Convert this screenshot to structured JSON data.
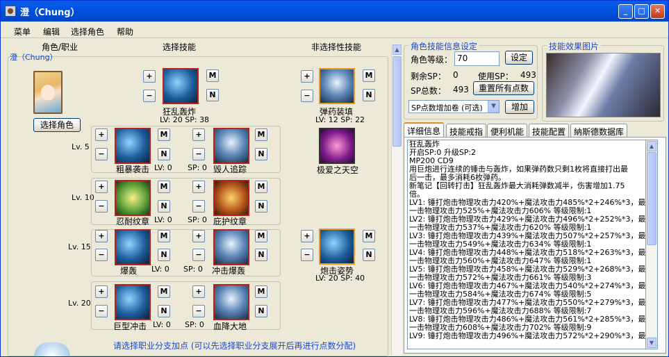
{
  "window": {
    "title": "澄（Chung）",
    "controls": {
      "minimize": "_",
      "maximize": "□",
      "close": "✕"
    }
  },
  "menu": [
    "菜单",
    "编辑",
    "选择角色",
    "帮助"
  ],
  "left": {
    "headers": {
      "role": "角色/职业",
      "active": "选择技能",
      "passive": "非选择性技能"
    },
    "char_name": "澄（Chung）",
    "select_role_button": "选择角色",
    "plus": "+",
    "minus": "−",
    "m": "M",
    "n": "N",
    "top_skills": [
      {
        "name": "狂乱轰炸",
        "lv": "LV: 20 SP: 38"
      },
      {
        "name": "弹药装填",
        "lv": "LV: 12 SP: 22"
      }
    ],
    "rows": [
      {
        "level": "Lv. 5",
        "skills": [
          {
            "name": "粗暴袭击",
            "lv": "LV: 0"
          },
          {
            "name": "毁人追踪",
            "lv": "SP: 0"
          }
        ],
        "passive": {
          "name": "极爱之天空"
        }
      },
      {
        "level": "Lv. 10",
        "skills": [
          {
            "name": "忍耐纹章",
            "lv": "LV: 0"
          },
          {
            "name": "庇护纹章",
            "lv": "SP: 0"
          }
        ]
      },
      {
        "level": "Lv. 15",
        "skills": [
          {
            "name": "爆轰",
            "lv": "LV: 0"
          },
          {
            "name": "冲击爆轰",
            "lv": "SP: 0"
          }
        ],
        "passive": {
          "name": "炮击姿势",
          "lv": "LV: 20 SP: 40"
        }
      },
      {
        "level": "Lv. 20",
        "skills": [
          {
            "name": "巨型冲击",
            "lv": "LV: 0"
          },
          {
            "name": "血降大地",
            "lv": "SP: 0"
          }
        ]
      }
    ],
    "hint": "请选择职业分支加点 (可以先选择职业分支展开后再进行点数分配)"
  },
  "settings": {
    "group_title": "角色技能信息设定",
    "level_label": "角色等级：",
    "level_value": "70",
    "set_button": "设定",
    "remaining_sp_label": "剩余SP：",
    "remaining_sp": "0",
    "used_sp_label": "使用SP：",
    "used_sp": "493",
    "total_sp_label": "SP总数：",
    "total_sp": "493",
    "reset_button": "重置所有点数",
    "scroll_select": "SP点数增加卷 (可选)",
    "add_button": "增加"
  },
  "effect": {
    "group_title": "技能效果图片"
  },
  "tabs": [
    "详细信息",
    "技能戒指",
    "便利机能",
    "技能配置",
    "納斯德数据库"
  ],
  "detail_lines": [
    "狂乱轰炸",
    "开启SP:0 升级SP:2",
    "MP200 CD9",
    "用巨炮进行连续的锤击与轰炸，如果弹药数只剩1枚将直接打出最",
    "后一击，最多消耗6枚弹药。",
    "新笔记【回转打击】狂乱轰炸最大消耗弹数减半，伤害增加1.75",
    "倍。",
    "LV1: 锤打炮击物理攻击力420%+魔法攻击力485%*2+246%*3，最后",
    "一击物理攻击力525%+魔法攻击力606%    等级限制:1",
    "LV2: 锤打炮击物理攻击力429%+魔法攻击力496%*2+252%*3，最后",
    "一击物理攻击力537%+魔法攻击力620%    等级限制:1",
    "LV3: 锤打炮击物理攻击力439%+魔法攻击力507%*2+257%*3，最后",
    "一击物理攻击力549%+魔法攻击力634%    等级限制:1",
    "LV4: 锤打炮击物理攻击力448%+魔法攻击力518%*2+263%*3，最后",
    "一击物理攻击力560%+魔法攻击力647%    等级限制:1",
    "LV5: 锤打炮击物理攻击力458%+魔法攻击力529%*2+268%*3，最后",
    "一击物理攻击力572%+魔法攻击力661%    等级限制:3",
    "LV6: 锤打炮击物理攻击力467%+魔法攻击力540%*2+274%*3，最后",
    "一击物理攻击力584%+魔法攻击力674%    等级限制:5",
    "LV7: 锤打炮击物理攻击力477%+魔法攻击力550%*2+279%*3，最后",
    "一击物理攻击力596%+魔法攻击力688%    等级限制:7",
    "LV8: 锤打炮击物理攻击力486%+魔法攻击力561%*2+285%*3，最后",
    "一击物理攻击力608%+魔法攻击力702%    等级限制:9",
    "LV9: 锤打炮击物理攻击力496%+魔法攻击力572%*2+290%*3，最后"
  ]
}
